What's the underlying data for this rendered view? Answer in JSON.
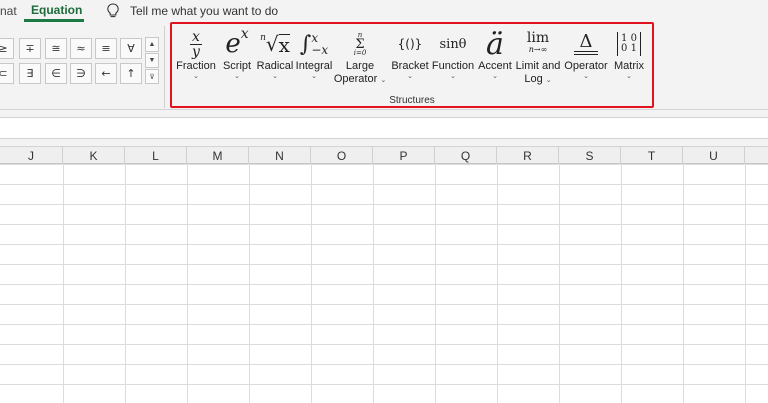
{
  "tabs": {
    "format_label": "nat",
    "equation_label": "Equation",
    "tell_me": "Tell me what you want to do"
  },
  "symbols": {
    "row1": [
      "≥",
      "∓",
      "≅",
      "≈",
      "≡",
      "∀"
    ],
    "row2": [
      "⊂",
      "∃",
      "∈",
      "∋",
      "←",
      "↑"
    ],
    "scroll": [
      "▲",
      "▼",
      "⊽"
    ]
  },
  "structures": {
    "group_label": "Structures",
    "items": [
      {
        "name": "fraction",
        "label": "Fraction",
        "icon": "fraction-icon"
      },
      {
        "name": "script",
        "label": "Script",
        "icon": "script-icon"
      },
      {
        "name": "radical",
        "label": "Radical",
        "icon": "radical-icon"
      },
      {
        "name": "integral",
        "label": "Integral",
        "icon": "integral-icon"
      },
      {
        "name": "large-operator",
        "label": "Large",
        "label2": "Operator",
        "icon": "large-operator-icon"
      },
      {
        "name": "bracket",
        "label": "Bracket",
        "icon": "bracket-icon"
      },
      {
        "name": "function",
        "label": "Function",
        "icon": "function-icon"
      },
      {
        "name": "accent",
        "label": "Accent",
        "icon": "accent-icon"
      },
      {
        "name": "limit-and-log",
        "label": "Limit and",
        "label2": "Log",
        "icon": "limit-icon"
      },
      {
        "name": "operator",
        "label": "Operator",
        "icon": "operator-icon"
      },
      {
        "name": "matrix",
        "label": "Matrix",
        "icon": "matrix-icon"
      }
    ],
    "glyphs": {
      "fraction_num": "x",
      "fraction_den": "y",
      "script_base": "e",
      "script_sup": "x",
      "radical_index": "n",
      "radical_base": "x",
      "integral_sym": "∫",
      "integral_up": "x",
      "integral_low": "−x",
      "largeop_top": "n",
      "largeop_sym": "Σ",
      "largeop_bot": "i=0",
      "bracket": "{()}",
      "function": "sinθ",
      "accent": "ä",
      "limit_top": "lim",
      "limit_bot": "n→∞",
      "operator": "Δ",
      "matrix_r1": "1 0",
      "matrix_r2": "0 1",
      "caret": "⌄"
    }
  },
  "columns": [
    "J",
    "K",
    "L",
    "M",
    "N",
    "O",
    "P",
    "Q",
    "R",
    "S",
    "T",
    "U"
  ]
}
